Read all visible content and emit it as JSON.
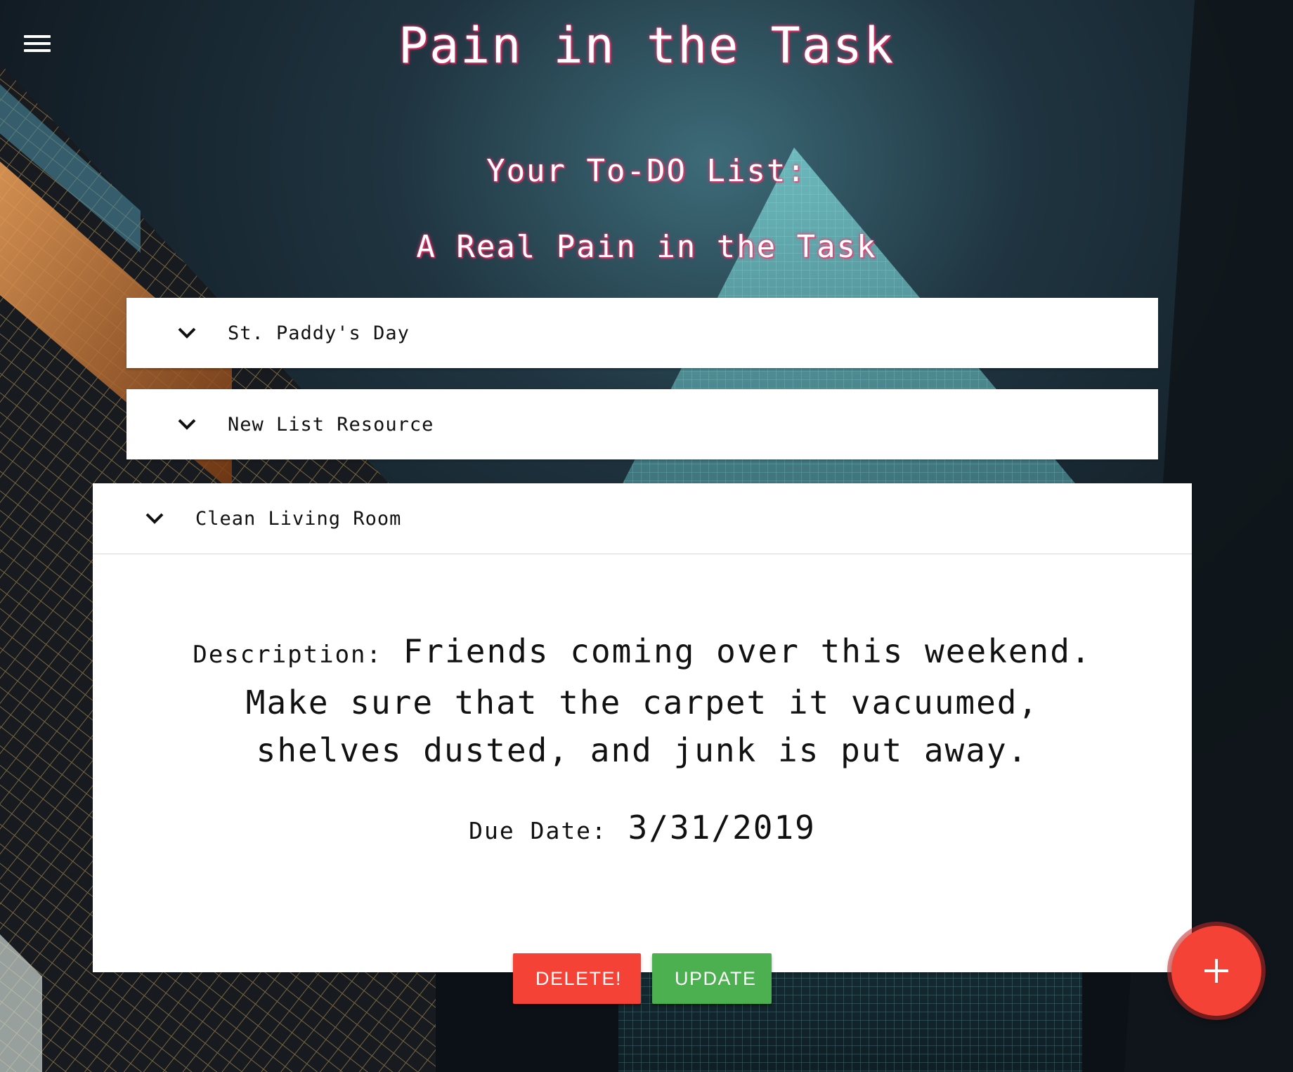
{
  "header": {
    "menu_icon": "hamburger-menu-icon",
    "title": "Pain in the Task",
    "subtitle_line1": "Your To-DO List:",
    "subtitle_line2": "A Real Pain in the Task"
  },
  "lists": [
    {
      "title": "St. Paddy's Day",
      "icon": "chevron-down-icon",
      "expanded": false
    },
    {
      "title": "New List Resource",
      "icon": "chevron-down-icon",
      "expanded": false
    },
    {
      "title": "Clean Living Room",
      "icon": "chevron-down-icon",
      "expanded": true,
      "description_label": "Description:",
      "description": "Friends coming over this weekend. Make sure that the carpet it vacuumed, shelves dusted, and junk is put away.",
      "due_label": "Due Date:",
      "due_date": "3/31/2019",
      "delete_label": "DELETE!",
      "update_label": "UPDATE"
    }
  ],
  "fab": {
    "icon": "plus-icon"
  },
  "colors": {
    "title_glow": "#ff2d6a",
    "delete": "#f44336",
    "update": "#4caf50",
    "fab": "#f44336"
  }
}
